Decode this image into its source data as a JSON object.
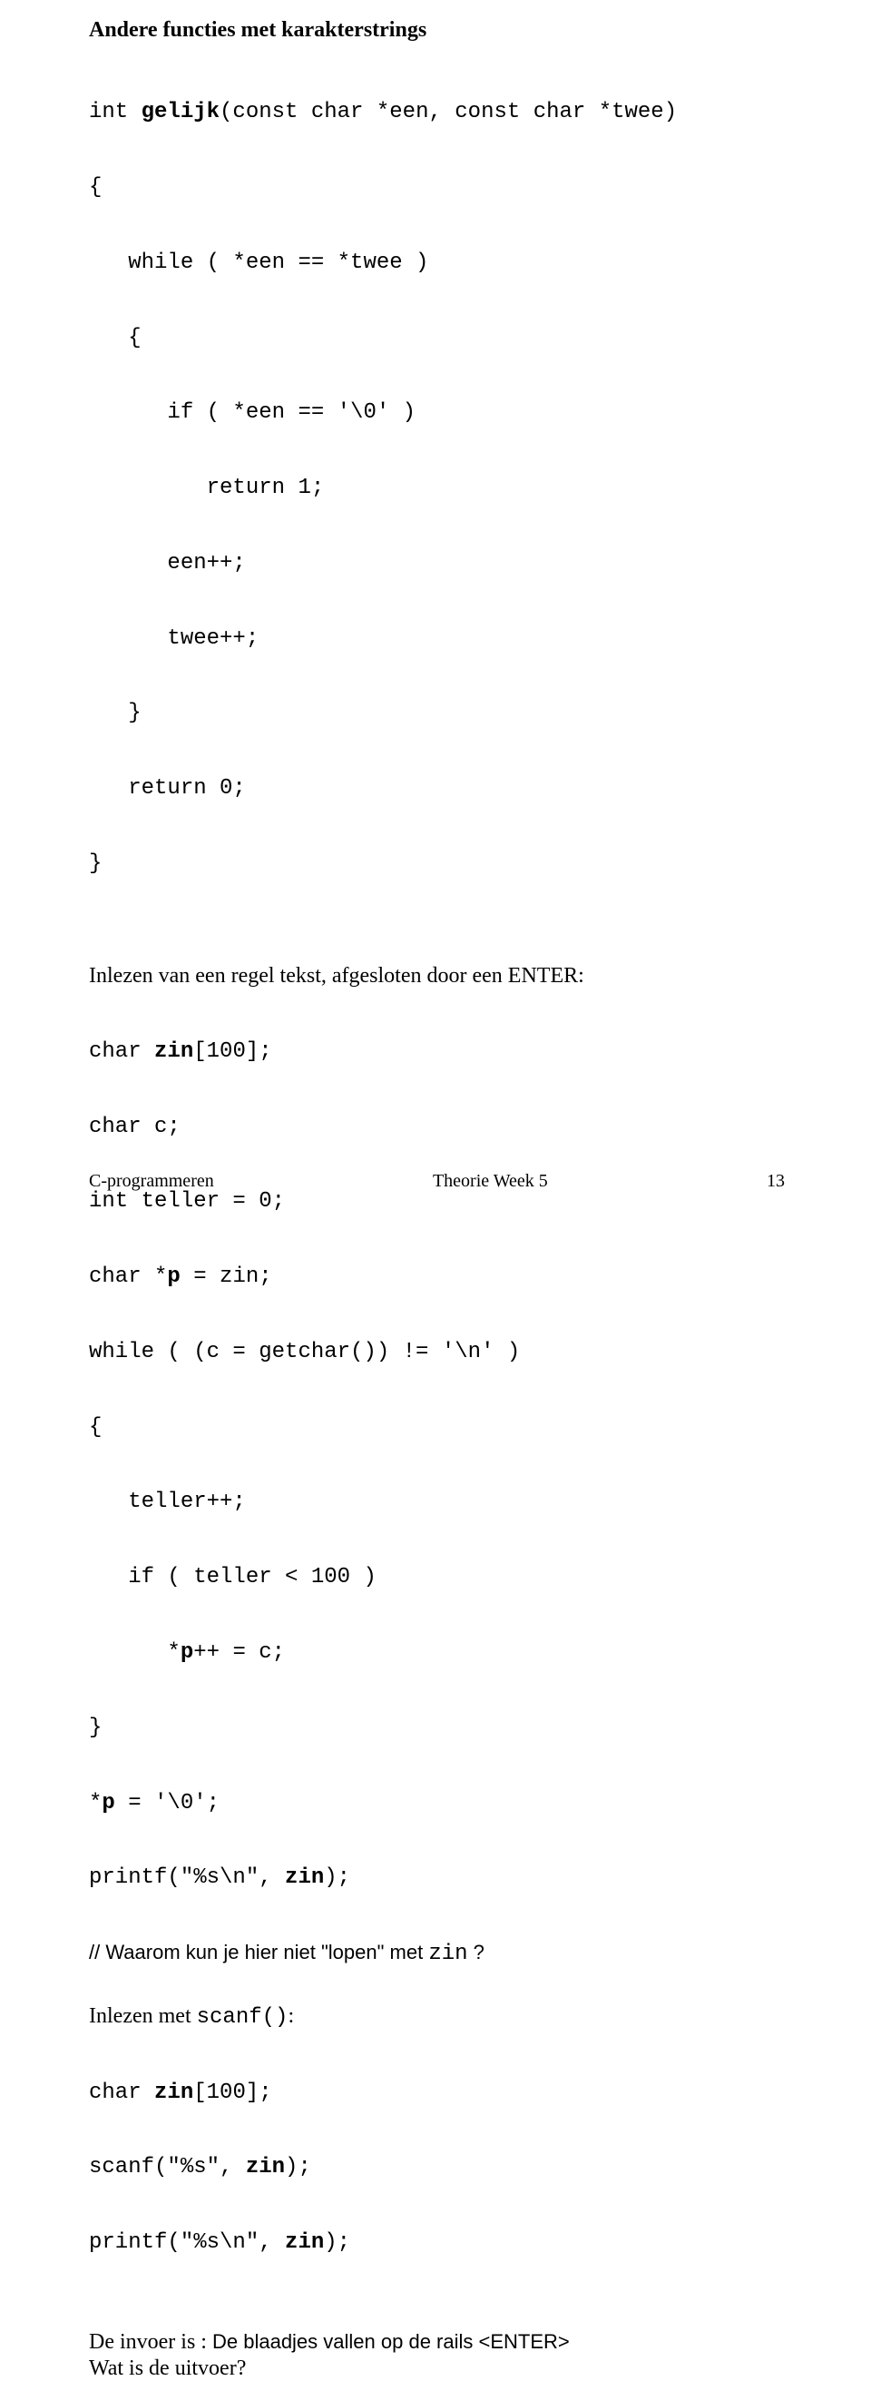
{
  "heading": "Andere functies met karakterstrings",
  "code1": {
    "l1a": "int ",
    "l1b": "gelijk",
    "l1c": "(const char *een, const char *twee)",
    "l2": "{",
    "l3": "   while ( *een == *twee )",
    "l4": "   {",
    "l5": "      if ( *een == '\\0' )",
    "l6": "         return 1;",
    "l7": "      een++;",
    "l8": "      twee++;",
    "l9": "   }",
    "l10": "   return 0;",
    "l11": "}"
  },
  "prose1": "Inlezen van een regel tekst, afgesloten door een ENTER:",
  "code2": {
    "l1a": "char ",
    "l1b": "zin",
    "l1c": "[100];",
    "l2": "char c;",
    "l3": "int teller = 0;",
    "l4a": "char *",
    "l4b": "p",
    "l4c": " = zin;",
    "l5": "while ( (c = getchar()) != '\\n' )",
    "l6": "{",
    "l7": "   teller++;",
    "l8": "   if ( teller < 100 )",
    "l9a": "      *",
    "l9b": "p",
    "l9c": "++ = c;",
    "l10": "}",
    "l11a": "*",
    "l11b": "p",
    "l11c": " = '\\0';",
    "l12a": "printf(\"%s\\n\", ",
    "l12b": "zin",
    "l12c": ");"
  },
  "comment1a": "// Waarom kun je hier niet \"lopen\" met ",
  "comment1b": "zin",
  "comment1c": " ?",
  "prose2a": "Inlezen met ",
  "prose2b": "scanf()",
  "prose2c": ":",
  "code3": {
    "l1a": "char ",
    "l1b": "zin",
    "l1c": "[100];",
    "l2a": "scanf(\"%s\", ",
    "l2b": "zin",
    "l2c": ");",
    "l3a": "printf(\"%s\\n\", ",
    "l3b": "zin",
    "l3c": ");"
  },
  "prose3a": "De invoer is : ",
  "prose3b": "De blaadjes vallen op de rails <ENTER>",
  "prose4": "Wat is de uitvoer?",
  "footer": {
    "left": "C-programmeren",
    "center": "Theorie Week 5",
    "right": "13"
  }
}
